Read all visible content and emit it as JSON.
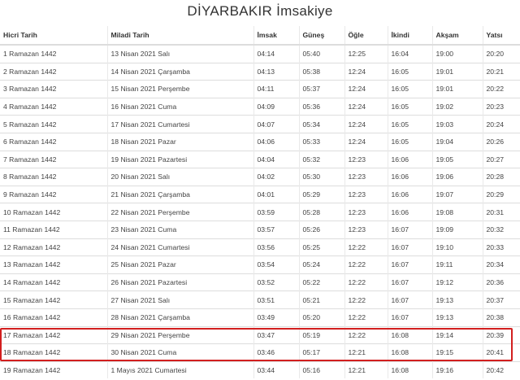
{
  "title": "DİYARBAKIR İmsakiye",
  "headers": [
    "Hicri Tarih",
    "Miladi Tarih",
    "İmsak",
    "Güneş",
    "Öğle",
    "İkindi",
    "Akşam",
    "Yatsı"
  ],
  "rows": [
    [
      "1 Ramazan 1442",
      "13 Nisan 2021 Salı",
      "04:14",
      "05:40",
      "12:25",
      "16:04",
      "19:00",
      "20:20"
    ],
    [
      "2 Ramazan 1442",
      "14 Nisan 2021 Çarşamba",
      "04:13",
      "05:38",
      "12:24",
      "16:05",
      "19:01",
      "20:21"
    ],
    [
      "3 Ramazan 1442",
      "15 Nisan 2021 Perşembe",
      "04:11",
      "05:37",
      "12:24",
      "16:05",
      "19:01",
      "20:22"
    ],
    [
      "4 Ramazan 1442",
      "16 Nisan 2021 Cuma",
      "04:09",
      "05:36",
      "12:24",
      "16:05",
      "19:02",
      "20:23"
    ],
    [
      "5 Ramazan 1442",
      "17 Nisan 2021 Cumartesi",
      "04:07",
      "05:34",
      "12:24",
      "16:05",
      "19:03",
      "20:24"
    ],
    [
      "6 Ramazan 1442",
      "18 Nisan 2021 Pazar",
      "04:06",
      "05:33",
      "12:24",
      "16:05",
      "19:04",
      "20:26"
    ],
    [
      "7 Ramazan 1442",
      "19 Nisan 2021 Pazartesi",
      "04:04",
      "05:32",
      "12:23",
      "16:06",
      "19:05",
      "20:27"
    ],
    [
      "8 Ramazan 1442",
      "20 Nisan 2021 Salı",
      "04:02",
      "05:30",
      "12:23",
      "16:06",
      "19:06",
      "20:28"
    ],
    [
      "9 Ramazan 1442",
      "21 Nisan 2021 Çarşamba",
      "04:01",
      "05:29",
      "12:23",
      "16:06",
      "19:07",
      "20:29"
    ],
    [
      "10 Ramazan 1442",
      "22 Nisan 2021 Perşembe",
      "03:59",
      "05:28",
      "12:23",
      "16:06",
      "19:08",
      "20:31"
    ],
    [
      "11 Ramazan 1442",
      "23 Nisan 2021 Cuma",
      "03:57",
      "05:26",
      "12:23",
      "16:07",
      "19:09",
      "20:32"
    ],
    [
      "12 Ramazan 1442",
      "24 Nisan 2021 Cumartesi",
      "03:56",
      "05:25",
      "12:22",
      "16:07",
      "19:10",
      "20:33"
    ],
    [
      "13 Ramazan 1442",
      "25 Nisan 2021 Pazar",
      "03:54",
      "05:24",
      "12:22",
      "16:07",
      "19:11",
      "20:34"
    ],
    [
      "14 Ramazan 1442",
      "26 Nisan 2021 Pazartesi",
      "03:52",
      "05:22",
      "12:22",
      "16:07",
      "19:12",
      "20:36"
    ],
    [
      "15 Ramazan 1442",
      "27 Nisan 2021 Salı",
      "03:51",
      "05:21",
      "12:22",
      "16:07",
      "19:13",
      "20:37"
    ],
    [
      "16 Ramazan 1442",
      "28 Nisan 2021 Çarşamba",
      "03:49",
      "05:20",
      "12:22",
      "16:07",
      "19:13",
      "20:38"
    ],
    [
      "17 Ramazan 1442",
      "29 Nisan 2021 Perşembe",
      "03:47",
      "05:19",
      "12:22",
      "16:08",
      "19:14",
      "20:39"
    ],
    [
      "18 Ramazan 1442",
      "30 Nisan 2021 Cuma",
      "03:46",
      "05:17",
      "12:21",
      "16:08",
      "19:15",
      "20:41"
    ],
    [
      "19 Ramazan 1442",
      "1 Mayıs 2021 Cumartesi",
      "03:44",
      "05:16",
      "12:21",
      "16:08",
      "19:16",
      "20:42"
    ]
  ],
  "highlighted_rows": [
    16,
    17
  ],
  "highlight_color": "#d21f1f"
}
